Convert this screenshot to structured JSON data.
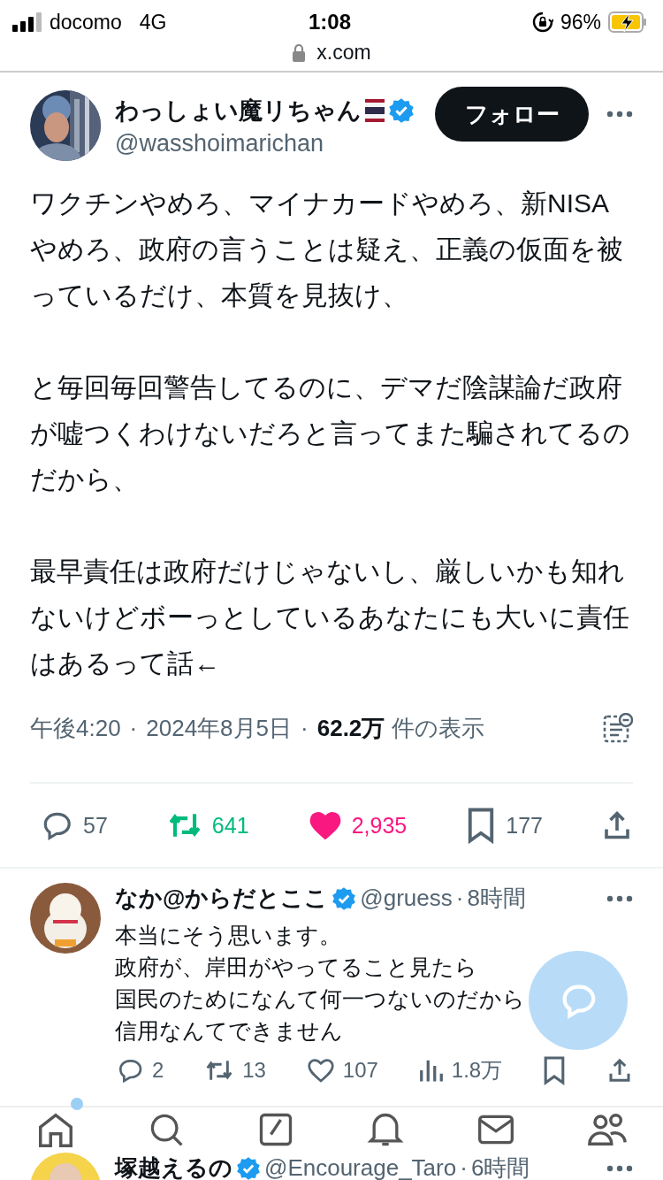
{
  "status_bar": {
    "carrier": "docomo",
    "network": "4G",
    "time": "1:08",
    "battery": "96%",
    "url": "x.com"
  },
  "tweet": {
    "name": "わっしょい魔リちゃん",
    "handle": "@wasshoimarichan",
    "follow_button": "フォロー",
    "paragraphs": [
      "ワクチンやめろ、マイナカードやめろ、新NISAやめろ、政府の言うことは疑え、正義の仮面を被っているだけ、本質を見抜け、",
      "と毎回毎回警告してるのに、デマだ陰謀論だ政府が嘘つくわけないだろと言ってまた騙されてるのだから、",
      "最早責任は政府だけじゃないし、厳しいかも知れないけどボーっとしているあなたにも大いに責任はあるって話←"
    ],
    "time": "午後4:20",
    "separators": [
      "·",
      "·"
    ],
    "date": "2024年8月5日",
    "views": "62.2万",
    "views_label": "件の表示",
    "actions": [
      {
        "kind": "reply",
        "count": "57",
        "selected": false
      },
      {
        "kind": "repost",
        "count": "641",
        "selected": true
      },
      {
        "kind": "like",
        "count": "2,935",
        "selected": true
      },
      {
        "kind": "bookmark",
        "count": "177",
        "selected": false
      },
      {
        "kind": "share"
      }
    ]
  },
  "replies": [
    {
      "name": "なか@からだとここ",
      "handle": "@gruess",
      "separator": "·",
      "time": "8時間",
      "lines": [
        "本当にそう思います。",
        "政府が、岸田がやってること見たら",
        "国民のためになんて何一つないのだから",
        "信用なんてできません"
      ],
      "actions": [
        {
          "kind": "reply",
          "count": "2"
        },
        {
          "kind": "repost",
          "count": "13"
        },
        {
          "kind": "like",
          "count": "107"
        },
        {
          "kind": "views",
          "count": "1.8万"
        },
        {
          "kind": "bookmark"
        },
        {
          "kind": "share"
        }
      ]
    },
    {
      "name": "塚越えるの",
      "handle": "@Encourage_Taro",
      "separator": "·",
      "time": "6時間"
    }
  ],
  "bottom_nav": [
    {
      "kind": "home",
      "badge": true
    },
    {
      "kind": "search",
      "badge": false
    },
    {
      "kind": "compose",
      "badge": false
    },
    {
      "kind": "bell",
      "badge": false
    },
    {
      "kind": "mail",
      "badge": false
    },
    {
      "kind": "people",
      "badge": false
    }
  ]
}
